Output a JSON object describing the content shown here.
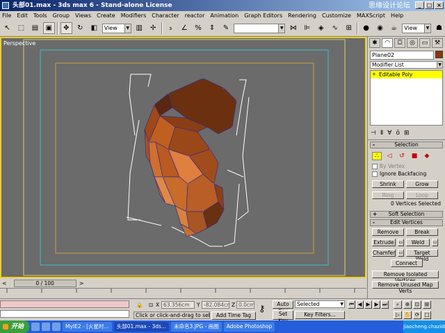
{
  "window": {
    "title": "头部01.max - 3ds max 6 - Stand-alone License",
    "watermark": "思缘设计论坛",
    "controls": [
      "_",
      "□",
      "×"
    ]
  },
  "menu": [
    "File",
    "Edit",
    "Tools",
    "Group",
    "Views",
    "Create",
    "Modifiers",
    "Character",
    "reactor",
    "Animation",
    "Graph Editors",
    "Rendering",
    "Customize",
    "MAXScript",
    "Help"
  ],
  "toolbar": {
    "coord_system": "View",
    "named_selection": "",
    "right_view": "View"
  },
  "viewport": {
    "label": "Perspective",
    "colors": {
      "background": "#6b6b6b",
      "active_border": "#f0d020",
      "safe_frame_outer": "#30c0d0",
      "safe_frame_inner": "#d0a040",
      "mesh": "#8b4513"
    }
  },
  "command_panel": {
    "object_name": "Plane02",
    "object_color": "#8b3510",
    "modifier_list": "Modifier List",
    "stack": [
      "Editable Poly"
    ],
    "selection_rollout": {
      "title": "Selection",
      "by_vertex": "By Vertex",
      "ignore_backfacing": "Ignore Backfacing",
      "shrink": "Shrink",
      "grow": "Grow",
      "ring": "Ring",
      "loop": "Loop",
      "info": "0 Vertices Selected"
    },
    "soft_selection": "Soft Selection",
    "edit_vertices": {
      "title": "Edit Vertices",
      "remove": "Remove",
      "break": "Break",
      "extrude": "Extrude",
      "weld": "Weld",
      "chamfer": "Chamfer",
      "target_weld": "Target Weld",
      "connect": "Connect",
      "remove_isolated": "Remove Isolated Vertices",
      "remove_unused": "Remove Unused Map Verts"
    }
  },
  "timeline": {
    "frame": "0 / 100"
  },
  "status": {
    "prompt": "Click or click-and-drag to select obj",
    "x_label": "X",
    "x_value": "63.356cm",
    "y_label": "Y",
    "y_value": "-82.084cm",
    "z_label": "Z",
    "z_value": "0.0cm",
    "auto_key": "Auto Key",
    "set_key": "Set Key",
    "selected": "Selected",
    "key_filters": "Key Filters...",
    "add_time_tag": "Add Time Tag"
  },
  "taskbar": {
    "start": "开始",
    "tasks": [
      "MyIE2 - [火星时...",
      "头部01.max - 3ds...",
      "未命名3.JPG - 画图",
      "Adobe Photoshop"
    ],
    "tray": "jiaocheng.chazidian.com"
  }
}
